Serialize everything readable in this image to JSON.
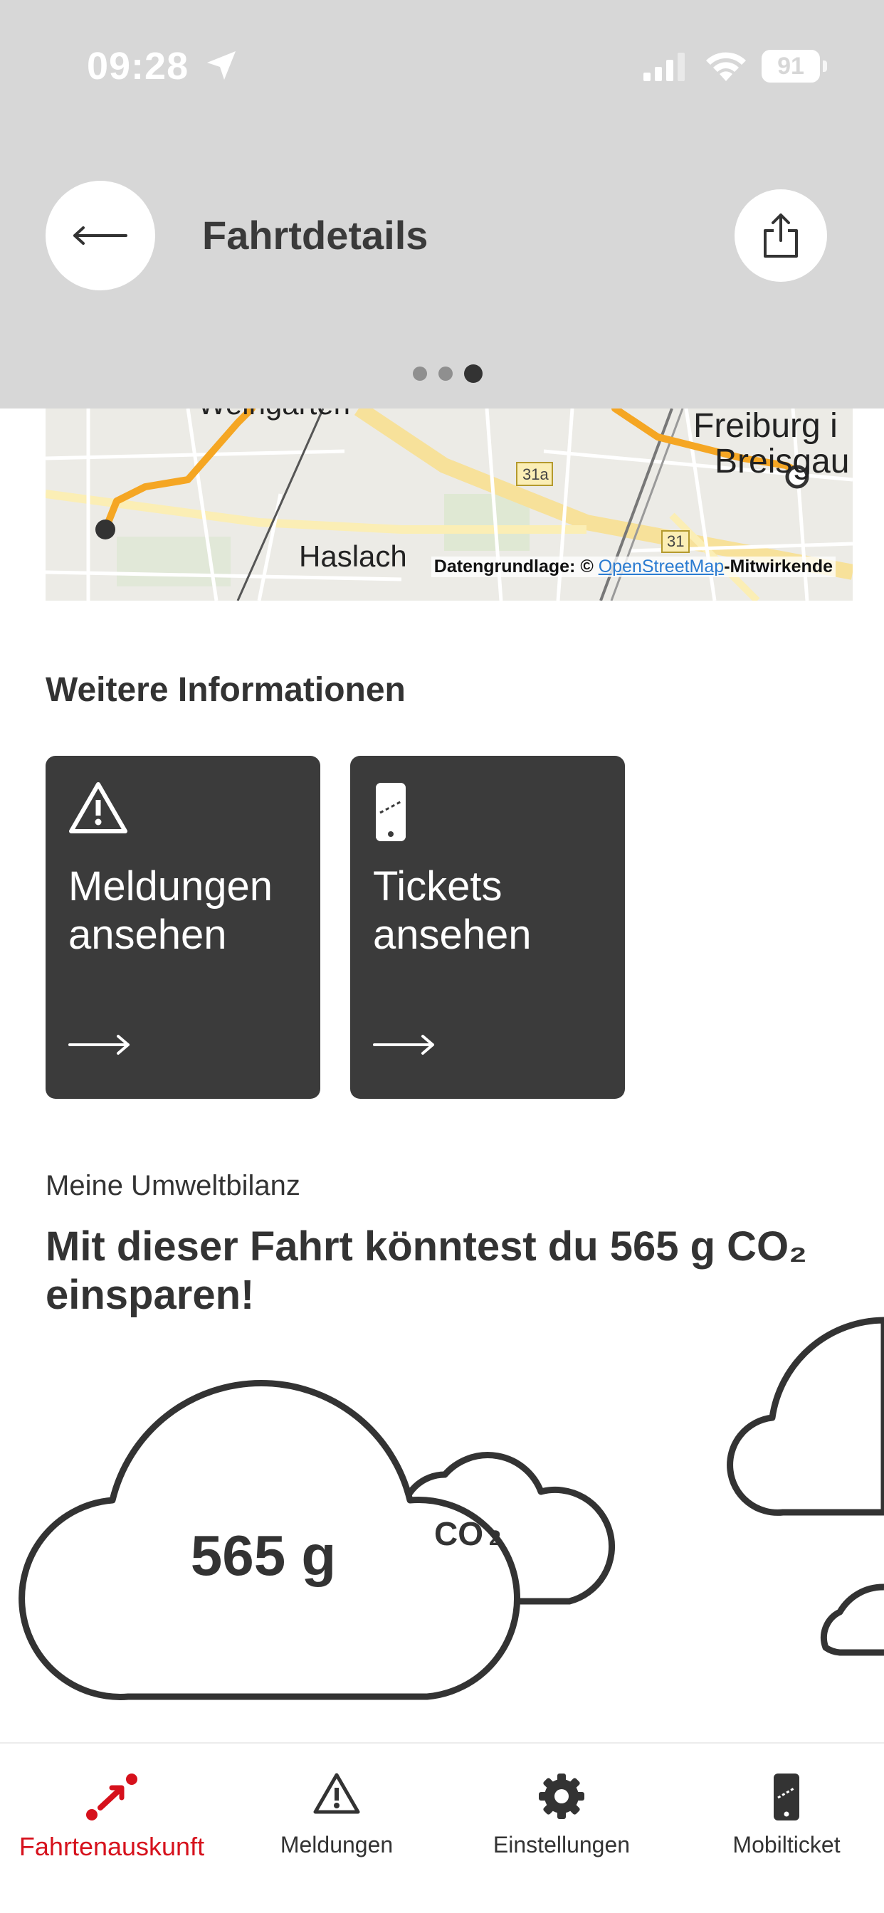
{
  "status_bar": {
    "time": "09:28",
    "battery": "91"
  },
  "header": {
    "title": "Fahrtdetails",
    "back_icon": "arrow-left-icon",
    "share_icon": "share-icon",
    "page_indicator": {
      "count": 3,
      "active": 3
    }
  },
  "map": {
    "labels": {
      "weingarten": "Weingarten",
      "haslach": "Haslach",
      "freiburg_1": "Freiburg i",
      "freiburg_2": "Breisgau",
      "road_1": "31a",
      "road_2": "31"
    },
    "attribution_prefix": "Datengrundlage: © ",
    "attribution_link": "OpenStreetMap",
    "attribution_suffix": "-Mitwirkende",
    "route_color": "#f5a623"
  },
  "info": {
    "title": "Weitere Informationen",
    "tiles": [
      {
        "label": "Meldungen ansehen",
        "icon": "warning-triangle-icon"
      },
      {
        "label": "Tickets ansehen",
        "icon": "mobile-ticket-icon"
      }
    ]
  },
  "eco": {
    "subtitle": "Meine Umweltbilanz",
    "headline": "Mit dieser Fahrt könntest du 565 g CO₂ einsparen!",
    "cloud_value": "565 g",
    "cloud_label": "CO",
    "cloud_label_sub": "2"
  },
  "tabbar": {
    "items": [
      {
        "label": "Fahrtenauskunft",
        "icon": "route-icon",
        "active": true
      },
      {
        "label": "Meldungen",
        "icon": "warning-triangle-icon",
        "active": false
      },
      {
        "label": "Einstellungen",
        "icon": "gear-icon",
        "active": false
      },
      {
        "label": "Mobilticket",
        "icon": "mobile-ticket-icon",
        "active": false
      }
    ]
  },
  "colors": {
    "accent": "#d6111c",
    "tile_bg": "#3b3b3b",
    "header_bg": "#d7d7d7"
  }
}
